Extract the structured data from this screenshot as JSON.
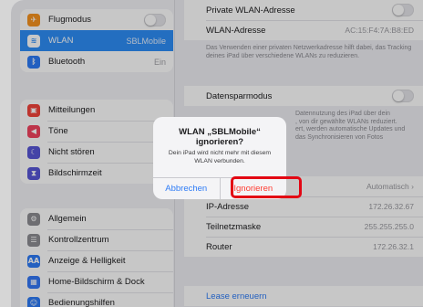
{
  "sidebar": {
    "group1": [
      {
        "label": "Flugmodus",
        "icon": "airplane-icon",
        "icon_color": "#f7931e",
        "glyph": "✈",
        "value": "",
        "toggle": true
      },
      {
        "label": "WLAN",
        "icon": "wifi-icon",
        "icon_color": "#2e8ef6",
        "glyph": "≋",
        "value": "SBLMobile",
        "active": true
      },
      {
        "label": "Bluetooth",
        "icon": "bluetooth-icon",
        "icon_color": "#2e7cf6",
        "glyph": "ᛒ",
        "value": "Ein"
      }
    ],
    "group2": [
      {
        "label": "Mitteilungen",
        "icon": "notifications-icon",
        "icon_color": "#f2433a",
        "glyph": "▣"
      },
      {
        "label": "Töne",
        "icon": "sounds-icon",
        "icon_color": "#f2435e",
        "glyph": "◀"
      },
      {
        "label": "Nicht stören",
        "icon": "moon-icon",
        "icon_color": "#5856d6",
        "glyph": "☾"
      },
      {
        "label": "Bildschirmzeit",
        "icon": "hourglass-icon",
        "icon_color": "#5856d6",
        "glyph": "⧗"
      }
    ],
    "group3": [
      {
        "label": "Allgemein",
        "icon": "gear-icon",
        "icon_color": "#8e8e93",
        "glyph": "⚙"
      },
      {
        "label": "Kontrollzentrum",
        "icon": "control-center-icon",
        "icon_color": "#8e8e93",
        "glyph": "☰"
      },
      {
        "label": "Anzeige & Helligkeit",
        "icon": "display-icon",
        "icon_color": "#2e7cf6",
        "glyph": "AA"
      },
      {
        "label": "Home-Bildschirm & Dock",
        "icon": "home-screen-icon",
        "icon_color": "#3478f6",
        "glyph": "▦"
      },
      {
        "label": "Bedienungshilfen",
        "icon": "accessibility-icon",
        "icon_color": "#2e7cf6",
        "glyph": "☺"
      }
    ]
  },
  "detail": {
    "private_address_label": "Private WLAN-Adresse",
    "wlan_address_label": "WLAN-Adresse",
    "wlan_address_value": "AC:15:F4:7A:B8:ED",
    "privacy_note": "Das Verwenden einer privaten Netzwerkadresse hilft dabei, das Tracking deines iPad über verschiedene WLANs zu reduzieren.",
    "data_saving_label": "Datensparmodus",
    "data_saving_note_lines": [
      "Datennutzung des iPad über dein",
      ", von dir gewählte WLANs reduziert.",
      "ert, werden automatische Updates und",
      "das Synchronisieren von Fotos"
    ],
    "ip_config_value": "Automatisch",
    "ip_label": "IP-Adresse",
    "ip_value": "172.26.32.67",
    "subnet_label": "Teilnetzmaske",
    "subnet_value": "255.255.255.0",
    "router_label": "Router",
    "router_value": "172.26.32.1",
    "renew_lease": "Lease erneuern"
  },
  "dialog": {
    "title": "WLAN „SBLMobile“ ignorieren?",
    "message": "Dein iPad wird nicht mehr mit diesem WLAN verbunden.",
    "cancel_label": "Abbrechen",
    "ignore_label": "Ignorieren"
  },
  "colors": {
    "accent": "#2e7cf6",
    "destructive": "#ff3b30",
    "highlight_frame": "#e30613"
  }
}
